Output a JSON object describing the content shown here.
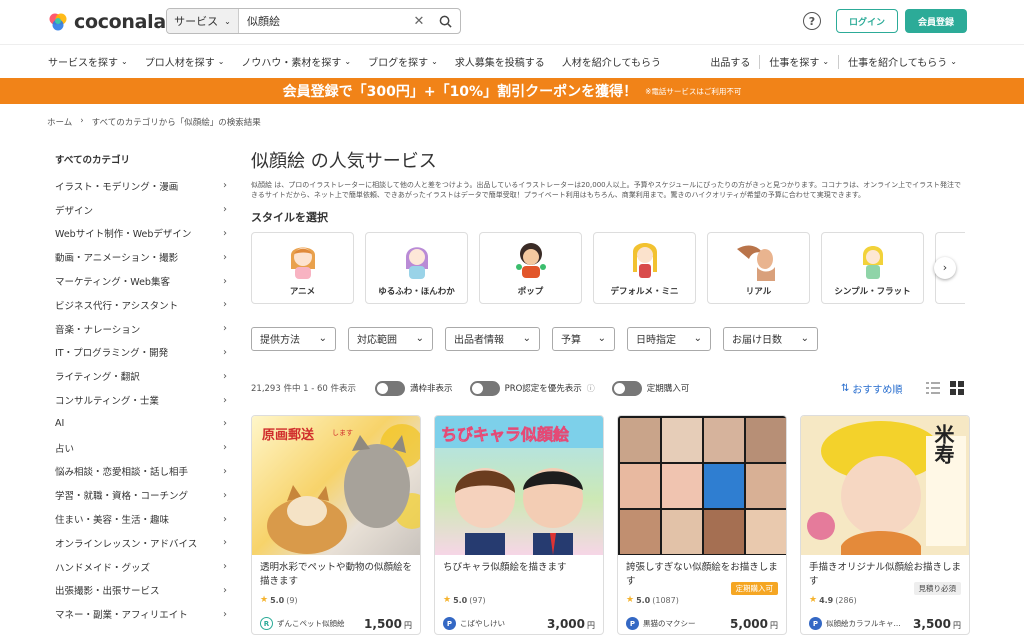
{
  "header": {
    "logo_text": "coconala",
    "search": {
      "type_label": "サービス",
      "query": "似顔絵"
    },
    "help_label": "?",
    "login_label": "ログイン",
    "signup_label": "会員登録"
  },
  "nav": {
    "left": [
      "サービスを探す",
      "プロ人材を探す",
      "ノウハウ・素材を探す",
      "ブログを探す",
      "求人募集を投稿する",
      "人材を紹介してもらう"
    ],
    "right": [
      "出品する",
      "仕事を探す",
      "仕事を紹介してもらう"
    ]
  },
  "banner": {
    "main": "会員登録で「300円」+「10%」割引クーポンを獲得！",
    "note": "※電話サービスはご利用不可"
  },
  "breadcrumb": [
    "ホーム",
    "すべてのカテゴリから「似顔絵」の検索結果"
  ],
  "sidebar": {
    "title": "すべてのカテゴリ",
    "items": [
      "イラスト・モデリング・漫画",
      "デザイン",
      "Webサイト制作・Webデザイン",
      "動画・アニメーション・撮影",
      "マーケティング・Web集客",
      "ビジネス代行・アシスタント",
      "音楽・ナレーション",
      "IT・プログラミング・開発",
      "ライティング・翻訳",
      "コンサルティング・士業",
      "AI",
      "占い",
      "悩み相談・恋愛相談・話し相手",
      "学習・就職・資格・コーチング",
      "住まい・美容・生活・趣味",
      "オンラインレッスン・アドバイス",
      "ハンドメイド・グッズ",
      "出張撮影・出張サービス",
      "マネー・副業・アフィリエイト"
    ]
  },
  "main": {
    "title": "似顔絵 の人気サービス",
    "description": "似顔絵 は、プロのイラストレーターに相談して他の人と差をつけよう。出品しているイラストレーターは20,000人以上。予算やスケジュールにぴったりの方がきっと見つかります。ココナラは、オンライン上でイラスト発注できるサイトだから、ネット上で簡単依頼、できあがったイラストはデータで簡単受取！プライベート利用はもちろん、商業利用まで。驚きのハイクオリティが希望の予算に合わせて実現できます。",
    "style_title": "スタイルを選択",
    "styles": [
      "アニメ",
      "ゆるふわ・ほんわか",
      "ポップ",
      "デフォルメ・ミニ",
      "リアル",
      "シンプル・フラット"
    ],
    "filters": [
      "提供方法",
      "対応範囲",
      "出品者情報",
      "予算",
      "日時指定",
      "お届け日数"
    ],
    "count": "21,293 件中 1 - 60 件表示",
    "toggles": [
      "満枠非表示",
      "PRO認定を優先表示",
      "定期購入可"
    ],
    "sort": "おすすめ順",
    "cards": [
      {
        "title": "透明水彩でペットや動物の似顔絵を描きます",
        "rating": "5.0",
        "reviews": "(9)",
        "seller": "ずんこペット似顔絵",
        "price": "1,500",
        "yen": "円",
        "badge": "",
        "thumb_text": "原画郵送",
        "thumb_sub": "します",
        "seller_icon": "R"
      },
      {
        "title": "ちびキャラ似顔絵を描きます",
        "rating": "5.0",
        "reviews": "(97)",
        "seller": "こばやしけい",
        "price": "3,000",
        "yen": "円",
        "badge": "",
        "thumb_text": "ちびキャラ似顔絵",
        "thumb_sub": "",
        "seller_icon": "P"
      },
      {
        "title": "誇張しすぎない似顔絵をお描きします",
        "rating": "5.0",
        "reviews": "(1087)",
        "seller": "黒猫のマクシー",
        "price": "5,000",
        "yen": "円",
        "badge": "定期購入可",
        "thumb_text": "",
        "thumb_sub": "",
        "seller_icon": "P"
      },
      {
        "title": "手描きオリジナル似顔絵お描きします",
        "rating": "4.9",
        "reviews": "(286)",
        "seller": "似顔絵カラフルキャ...",
        "price": "3,500",
        "yen": "円",
        "badge": "見積り必須",
        "thumb_text": "米寿",
        "thumb_sub": "",
        "seller_icon": "P"
      }
    ]
  }
}
